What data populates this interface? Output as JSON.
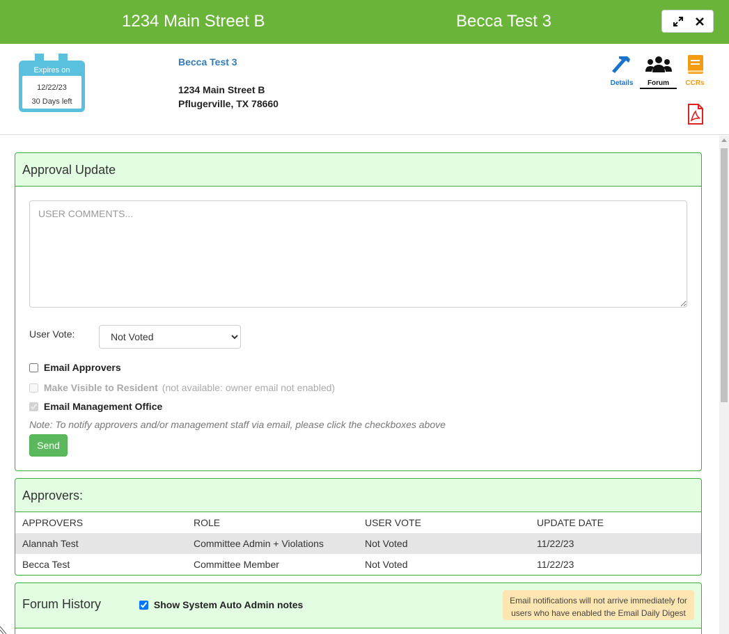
{
  "topbar": {
    "address": "1234 Main Street B",
    "owner": "Becca Test 3",
    "expand_icon": "expand-icon",
    "close_icon": "close-icon"
  },
  "header": {
    "calendar": {
      "label": "Expires on",
      "date": "12/22/23",
      "days_left": "30 Days left"
    },
    "owner_link": "Becca Test 3",
    "address_line1": "1234 Main Street B",
    "address_line2": "Pflugerville, TX 78660",
    "nav": {
      "details": "Details",
      "forum": "Forum",
      "ccrs": "CCRs"
    },
    "colors": {
      "details": "#1a73c9",
      "forum": "#111111",
      "ccrs": "#f39c12",
      "pdf": "#e02020"
    }
  },
  "approval_update": {
    "title": "Approval Update",
    "comments_placeholder": "USER COMMENTS...",
    "vote_label": "User Vote:",
    "vote_selected": "Not Voted",
    "email_approvers": "Email Approvers",
    "make_visible": "Make Visible to Resident",
    "make_visible_note": "(not available: owner email not enabled)",
    "email_management": "Email Management Office",
    "notify_note": "Note: To notify approvers and/or management staff via email, please click the checkboxes above",
    "send_label": "Send"
  },
  "approvers": {
    "title": "Approvers:",
    "headers": [
      "APPROVERS",
      "ROLE",
      "USER VOTE",
      "UPDATE DATE"
    ],
    "rows": [
      [
        "Alannah Test",
        "Committee Admin + Violations",
        "Not Voted",
        "11/22/23"
      ],
      [
        "Becca Test",
        "Committee Member",
        "Not Voted",
        "11/22/23"
      ]
    ]
  },
  "forum_history": {
    "title": "Forum History",
    "show_system_notes": "Show System Auto Admin notes",
    "digest_notice": "Email notifications will not arrive immediately for users who have enabled the Email Daily Digest"
  },
  "colors": {
    "topbar": "#6ab43a",
    "panel_border": "#3cab3c",
    "panel_header": "#e3fde3",
    "send": "#5cb85c",
    "calendar": "#5bc0de",
    "digest": "#fde6b1"
  }
}
